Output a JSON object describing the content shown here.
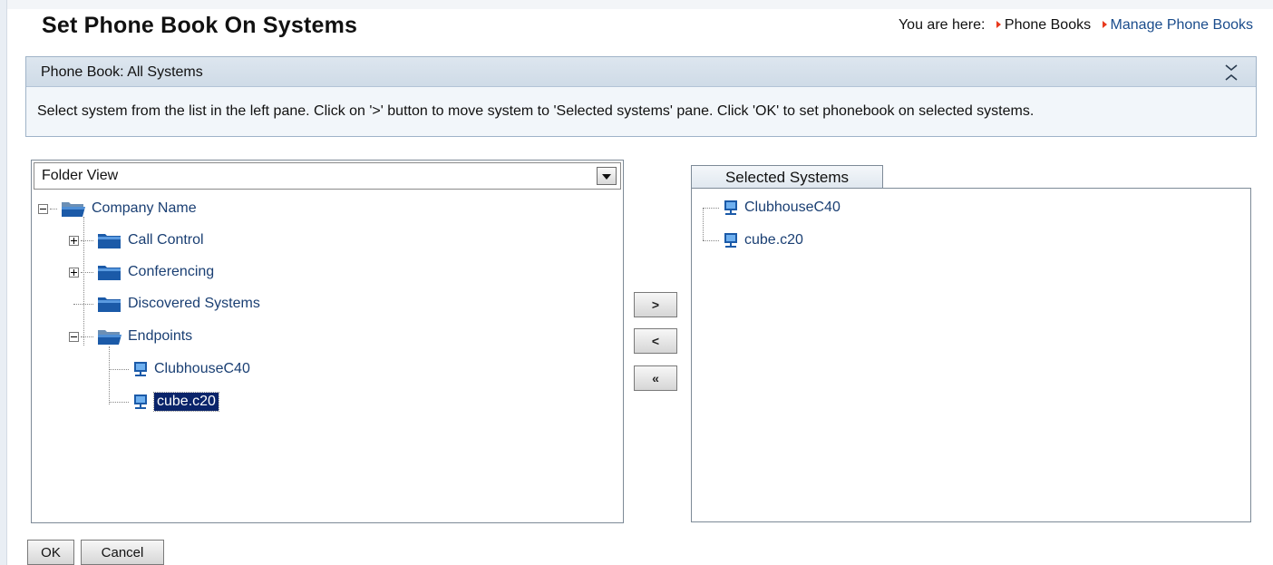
{
  "header": {
    "title": "Set Phone Book On Systems",
    "breadcrumb_prefix": "You are here:",
    "breadcrumb": [
      "Phone Books",
      "Manage Phone Books"
    ]
  },
  "info_panel": {
    "title": "Phone Book: All Systems",
    "instructions": "Select system from the list in the left pane. Click on '>' button to move system to 'Selected systems' pane. Click 'OK' to set phonebook on selected systems."
  },
  "tree_pane": {
    "view_select": "Folder View",
    "root": "Company Name",
    "folders": [
      "Call Control",
      "Conferencing",
      "Discovered Systems",
      "Endpoints"
    ],
    "endpoints": [
      "ClubhouseC40",
      "cube.c20"
    ],
    "selected_item": "cube.c20"
  },
  "move_buttons": {
    "add": ">",
    "remove": "<",
    "remove_all": "«"
  },
  "selected_pane": {
    "tab_label": "Selected Systems",
    "items": [
      "ClubhouseC40",
      "cube.c20"
    ]
  },
  "actions": {
    "ok": "OK",
    "cancel": "Cancel"
  },
  "colors": {
    "link": "#1a4c8c",
    "tree_text": "#1a3f73",
    "selection": "#0a246a",
    "breadcrumb_arrow": "#e8391d",
    "panel_header": "#d6e0ea"
  }
}
